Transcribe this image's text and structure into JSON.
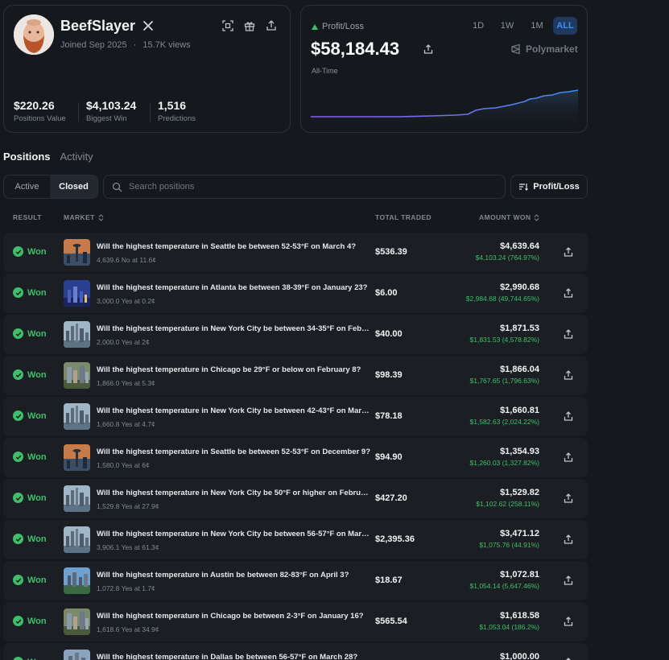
{
  "profile": {
    "username": "BeefSlayer",
    "joined": "Joined Sep 2025",
    "views": "15.7K views",
    "stats": [
      {
        "value": "$220.26",
        "label": "Positions Value"
      },
      {
        "value": "$4,103.24",
        "label": "Biggest Win"
      },
      {
        "value": "1,516",
        "label": "Predictions"
      }
    ]
  },
  "pnl": {
    "label": "Profit/Loss",
    "value": "$58,184.43",
    "sub": "All-Time",
    "ranges": [
      "1D",
      "1W",
      "1M",
      "ALL"
    ],
    "active_range": "ALL",
    "brand": "Polymarket"
  },
  "tabs": {
    "positions": "Positions",
    "activity": "Activity"
  },
  "filter": {
    "active": "Active",
    "closed": "Closed"
  },
  "search": {
    "placeholder": "Search positions"
  },
  "sort_button": "Profit/Loss",
  "columns": {
    "result": "RESULT",
    "market": "MARKET",
    "traded": "TOTAL TRADED",
    "won": "AMOUNT WON"
  },
  "rows": [
    {
      "result": "Won",
      "thumb": "seattle",
      "title": "Will the highest temperature in Seattle be between 52-53°F on March 4?",
      "sub": "4,639.6 No at 11.6¢",
      "traded": "$536.39",
      "amount": "$4,639.64",
      "gain": "$4,103.24 (764.97%)"
    },
    {
      "result": "Won",
      "thumb": "atlanta",
      "title": "Will the highest temperature in Atlanta be between 38-39°F on January 23?",
      "sub": "3,000.0 Yes at 0.2¢",
      "traded": "$6.00",
      "amount": "$2,990.68",
      "gain": "$2,984.68 (49,744.65%)"
    },
    {
      "result": "Won",
      "thumb": "nyc",
      "title": "Will the highest temperature in New York City be between 34-35°F on February 12?",
      "sub": "2,000.0 Yes at 2¢",
      "traded": "$40.00",
      "amount": "$1,871.53",
      "gain": "$1,831.53 (4,578.82%)"
    },
    {
      "result": "Won",
      "thumb": "chicago",
      "title": "Will the highest temperature in Chicago be 29°F or below on February 8?",
      "sub": "1,866.0 Yes at 5.3¢",
      "traded": "$98.39",
      "amount": "$1,866.04",
      "gain": "$1,767.65 (1,796.63%)"
    },
    {
      "result": "Won",
      "thumb": "nyc",
      "title": "Will the highest temperature in New York City be between 42-43°F on March 1?",
      "sub": "1,660.8 Yes at 4.7¢",
      "traded": "$78.18",
      "amount": "$1,660.81",
      "gain": "$1,582.63 (2,024.22%)"
    },
    {
      "result": "Won",
      "thumb": "seattle",
      "title": "Will the highest temperature in Seattle be between 52-53°F on December 9?",
      "sub": "1,580.0 Yes at 6¢",
      "traded": "$94.90",
      "amount": "$1,354.93",
      "gain": "$1,260.03 (1,327.82%)"
    },
    {
      "result": "Won",
      "thumb": "nyc",
      "title": "Will the highest temperature in New York City be 50°F or higher on February 20?",
      "sub": "1,529.8 Yes at 27.9¢",
      "traded": "$427.20",
      "amount": "$1,529.82",
      "gain": "$1,102.62 (258.11%)"
    },
    {
      "result": "Won",
      "thumb": "nyc",
      "title": "Will the highest temperature in New York City be between 56-57°F on March 15?",
      "sub": "3,906.1 Yes at 61.3¢",
      "traded": "$2,395.36",
      "amount": "$3,471.12",
      "gain": "$1,075.76 (44.91%)"
    },
    {
      "result": "Won",
      "thumb": "austin",
      "title": "Will the highest temperature in Austin be between 82-83°F on April 3?",
      "sub": "1,072.8 Yes at 1.7¢",
      "traded": "$18.67",
      "amount": "$1,072.81",
      "gain": "$1,054.14 (5,647.46%)"
    },
    {
      "result": "Won",
      "thumb": "chicago",
      "title": "Will the highest temperature in Chicago be between 2-3°F on January 16?",
      "sub": "1,618.6 Yes at 34.9¢",
      "traded": "$565.54",
      "amount": "$1,618.58",
      "gain": "$1,053.04 (186.2%)"
    },
    {
      "result": "Won",
      "thumb": "dallas",
      "title": "Will the highest temperature in Dallas be between 56-57°F on March 28?",
      "sub": "",
      "traded": "",
      "amount": "$1,000.00",
      "gain": ""
    }
  ]
}
